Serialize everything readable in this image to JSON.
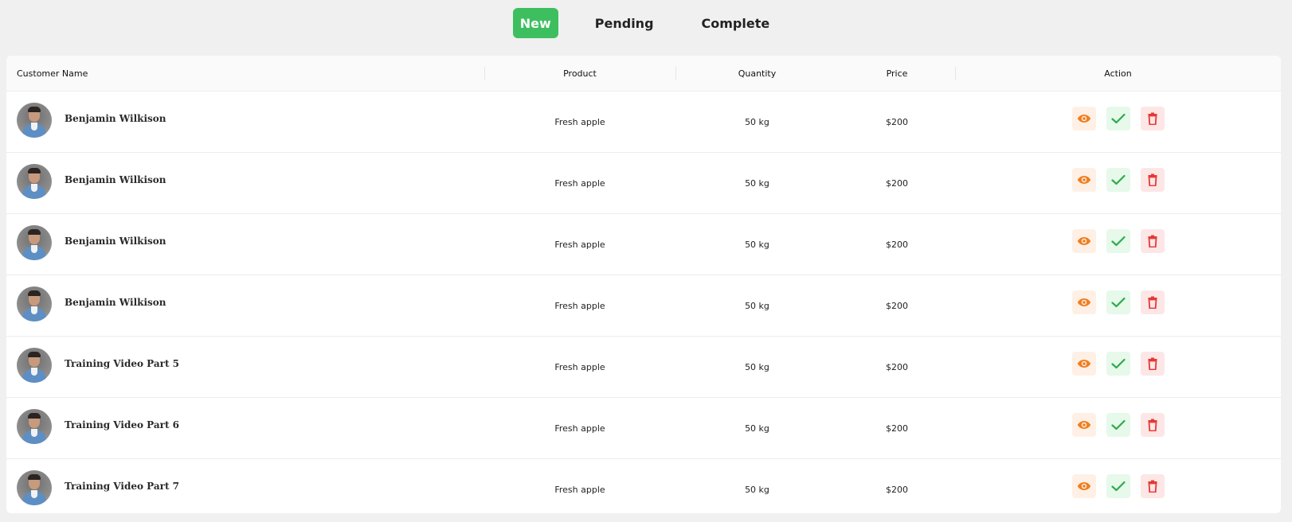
{
  "tabs": [
    {
      "label": "New",
      "active": true
    },
    {
      "label": "Pending",
      "active": false
    },
    {
      "label": "Complete",
      "active": false
    }
  ],
  "table": {
    "headers": {
      "customer": "Customer Name",
      "product": "Product",
      "quantity": "Quantity",
      "price": "Price",
      "action": "Action"
    },
    "rows": [
      {
        "name": "Benjamin Wilkison",
        "product": "Fresh apple",
        "quantity": "50 kg",
        "price": "$200"
      },
      {
        "name": "Benjamin Wilkison",
        "product": "Fresh apple",
        "quantity": "50 kg",
        "price": "$200"
      },
      {
        "name": "Benjamin Wilkison",
        "product": "Fresh apple",
        "quantity": "50 kg",
        "price": "$200"
      },
      {
        "name": "Benjamin Wilkison",
        "product": "Fresh apple",
        "quantity": "50 kg",
        "price": "$200"
      },
      {
        "name": "Training Video Part 5",
        "product": "Fresh apple",
        "quantity": "50 kg",
        "price": "$200"
      },
      {
        "name": "Training Video Part 6",
        "product": "Fresh apple",
        "quantity": "50 kg",
        "price": "$200"
      },
      {
        "name": "Training Video Part 7",
        "product": "Fresh apple",
        "quantity": "50 kg",
        "price": "$200"
      }
    ]
  },
  "colors": {
    "active_tab": "#3dbf5f",
    "view_icon": "#f07d1f",
    "check_icon": "#2faa4c",
    "delete_icon": "#e53935"
  },
  "icons": [
    "eye-icon",
    "check-icon",
    "trash-icon"
  ]
}
